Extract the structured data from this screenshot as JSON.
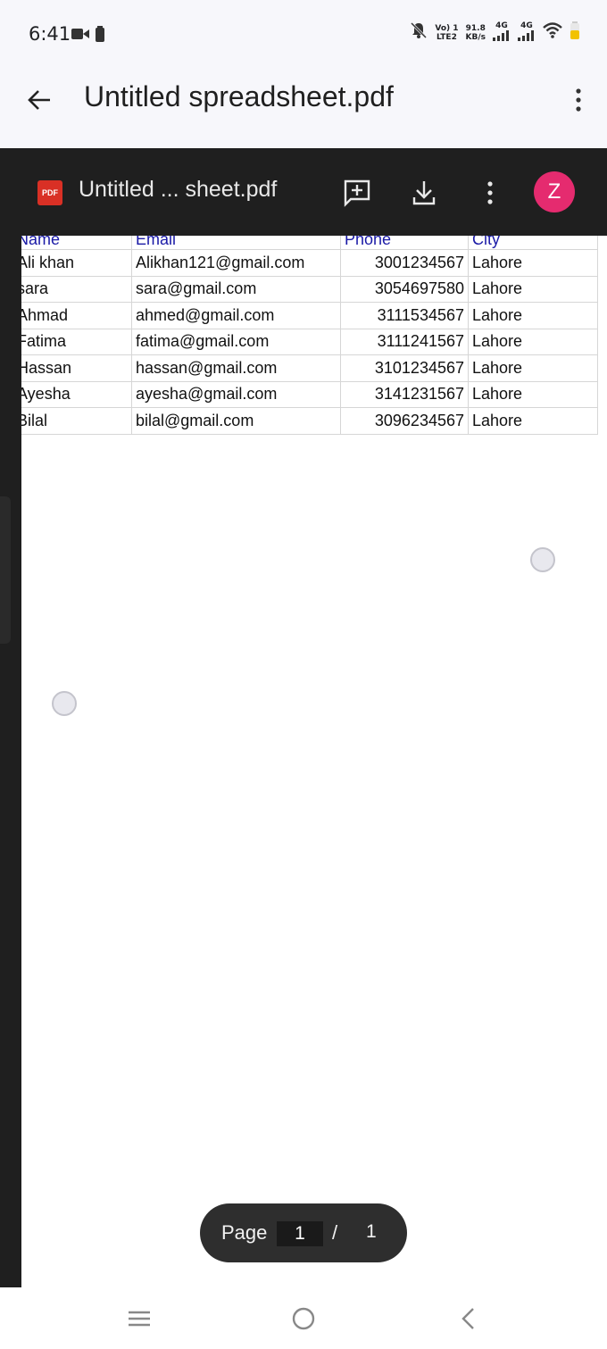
{
  "status_bar": {
    "time": "6:41",
    "volte": "Vo) 1",
    "lte": "LTE2",
    "speed_value": "91.8",
    "speed_unit": "KB/s",
    "net1": "4G",
    "net2": "4G"
  },
  "app_bar": {
    "title": "Untitled spreadsheet.pdf"
  },
  "viewer": {
    "badge": "PDF",
    "title": "Untitled ... sheet.pdf",
    "avatar_initial": "Z"
  },
  "sheet": {
    "headers": [
      "Name",
      "Email",
      "Phone",
      "City"
    ],
    "rows": [
      [
        "Ali khan",
        "Alikhan121@gmail.com",
        "3001234567",
        "Lahore"
      ],
      [
        "sara",
        "sara@gmail.com",
        "3054697580",
        "Lahore"
      ],
      [
        "Ahmad",
        "ahmed@gmail.com",
        "3111534567",
        "Lahore"
      ],
      [
        "Fatima",
        "fatima@gmail.com",
        "3111241567",
        "Lahore"
      ],
      [
        "Hassan",
        "hassan@gmail.com",
        "3101234567",
        "Lahore"
      ],
      [
        "Ayesha",
        "ayesha@gmail.com",
        "3141231567",
        "Lahore"
      ],
      [
        "Bilal",
        "bilal@gmail.com",
        "3096234567",
        "Lahore"
      ]
    ]
  },
  "pager": {
    "label": "Page",
    "current": "1",
    "separator": "/",
    "total": "1"
  },
  "colors": {
    "avatar": "#e52b6f",
    "pdf_badge": "#d93025",
    "header_text": "#1a1aa6"
  }
}
